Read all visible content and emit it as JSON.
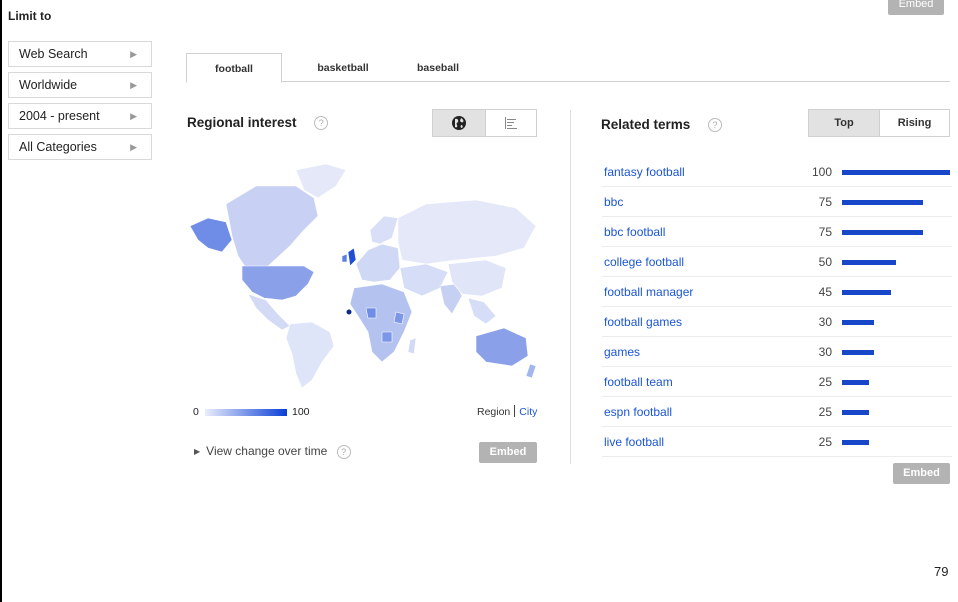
{
  "header": {
    "limit_title": "Limit to",
    "embed_top": "Embed"
  },
  "filters": [
    {
      "label": "Web Search"
    },
    {
      "label": "Worldwide"
    },
    {
      "label": "2004 - present"
    },
    {
      "label": "All Categories"
    }
  ],
  "tabs": [
    {
      "label": "football",
      "active": true
    },
    {
      "label": "basketball",
      "active": false
    },
    {
      "label": "baseball",
      "active": false
    }
  ],
  "regional": {
    "title": "Regional interest",
    "help": "?",
    "view_toggle": [
      "globe-icon",
      "list-icon"
    ],
    "legend_min": "0",
    "legend_max": "100",
    "region_label": "Region",
    "city_label": "City",
    "view_change": "View change over time",
    "embed": "Embed",
    "colors": {
      "low": "#eaedfb",
      "high": "#0a3fd6"
    }
  },
  "related": {
    "title": "Related terms",
    "help": "?",
    "toggle_top": "Top",
    "toggle_rising": "Rising",
    "embed": "Embed",
    "terms": [
      {
        "term": "fantasy football",
        "value": 100
      },
      {
        "term": "bbc",
        "value": 75
      },
      {
        "term": "bbc football",
        "value": 75
      },
      {
        "term": "college football",
        "value": 50
      },
      {
        "term": "football manager",
        "value": 45
      },
      {
        "term": "football games",
        "value": 30
      },
      {
        "term": "games",
        "value": 30
      },
      {
        "term": "football team",
        "value": 25
      },
      {
        "term": "espn football",
        "value": 25
      },
      {
        "term": "live football",
        "value": 25
      }
    ],
    "bar_color": "#1746c9"
  },
  "page_number": "79"
}
